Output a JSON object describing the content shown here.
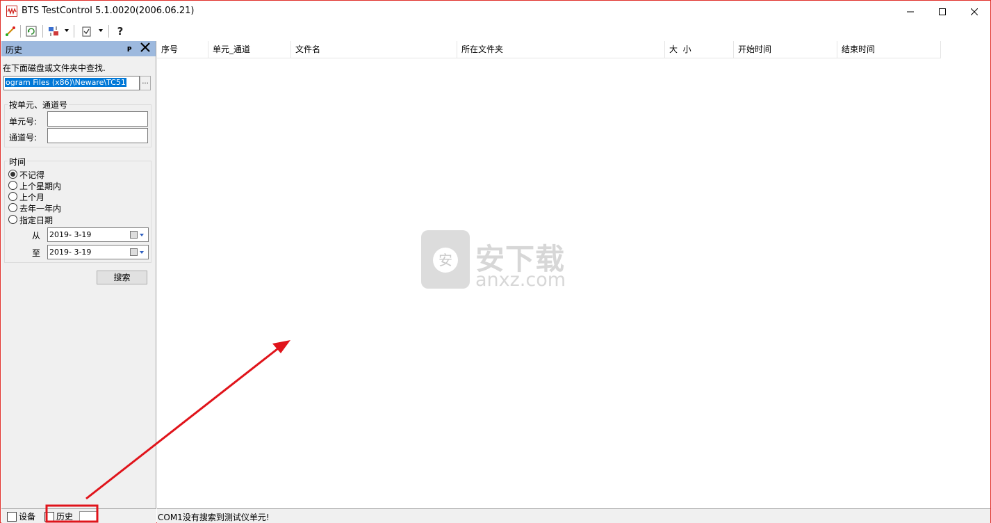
{
  "window": {
    "title": "BTS TestControl 5.1.0020(2006.06.21)"
  },
  "toolbar": {
    "buttons": [
      "connect-icon",
      "refresh-icon",
      "transfer-icon",
      "checklist-icon",
      "help-icon"
    ],
    "help_glyph": "?"
  },
  "left_panel": {
    "title": "历史",
    "pin_glyph": "ᴘ",
    "search_hint": "在下面磁盘或文件夹中查找.",
    "path_value": "ogram Files (x86)\\Neware\\TC51",
    "browse_label": "...",
    "unit_group": {
      "title": "按单元、通道号",
      "unit_label": "单元号:",
      "channel_label": "通道号:",
      "unit_value": "",
      "channel_value": ""
    },
    "time_group": {
      "title": "时间",
      "options": [
        "不记得",
        "上个星期内",
        "上个月",
        "去年一年内",
        "指定日期"
      ],
      "selected": "不记得",
      "from_label": "从",
      "to_label": "至",
      "from_date": "2019- 3-19",
      "to_date": "2019- 3-19"
    },
    "search_button": "搜索"
  },
  "bottom_tabs": {
    "device": "设备",
    "history": "历史"
  },
  "list": {
    "columns": [
      "序号",
      "单元_通道",
      "文件名",
      "所在文件夹",
      "大  小",
      "开始时间",
      "结束时间"
    ]
  },
  "watermark": {
    "big": "安下载",
    "small": "anxz.com",
    "shield": "安"
  },
  "status": {
    "text": "COM1没有搜索到测试仪单元!"
  },
  "colors": {
    "accent": "#0078d7",
    "panel_header": "#9db9de",
    "annotation_red": "#e0141b"
  }
}
